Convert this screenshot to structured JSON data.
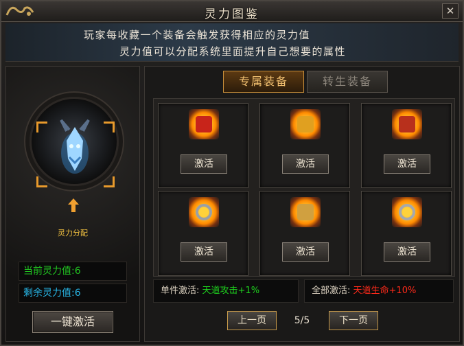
{
  "window": {
    "title": "灵力图鉴",
    "close_symbol": "✕"
  },
  "description": {
    "line1": "玩家每收藏一个装备会触发获得相应的灵力值",
    "line2": "灵力值可以分配系统里面提升自己想要的属性"
  },
  "left_panel": {
    "alloc_label": "灵力分配",
    "current_label": "当前灵力值:",
    "current_value": "6",
    "remaining_label": "剩余灵力值:",
    "remaining_value": "6",
    "one_click_button": "一键激活"
  },
  "tabs": [
    {
      "label": "专属装备",
      "active": true
    },
    {
      "label": "转生装备",
      "active": false
    }
  ],
  "items": [
    {
      "icon": "red-claw-icon",
      "button": "激活",
      "color": "#c8241a"
    },
    {
      "icon": "golden-figure-icon",
      "button": "激活",
      "color": "#e0a020"
    },
    {
      "icon": "red-boots-icon",
      "button": "激活",
      "color": "#b8301c"
    },
    {
      "icon": "silver-ring-icon",
      "button": "激活",
      "color": "#9aa0a6"
    },
    {
      "icon": "gold-bracelet-icon",
      "button": "激活",
      "color": "#d0a040"
    },
    {
      "icon": "silver-ring-icon",
      "button": "激活",
      "color": "#a6a8ac"
    }
  ],
  "bonus": {
    "single_label": "单件激活:",
    "single_value": "天道攻击+1%",
    "all_label": "全部激活:",
    "all_value": "天道生命+10%"
  },
  "pager": {
    "prev": "上一页",
    "next": "下一页",
    "page": "5/5"
  }
}
